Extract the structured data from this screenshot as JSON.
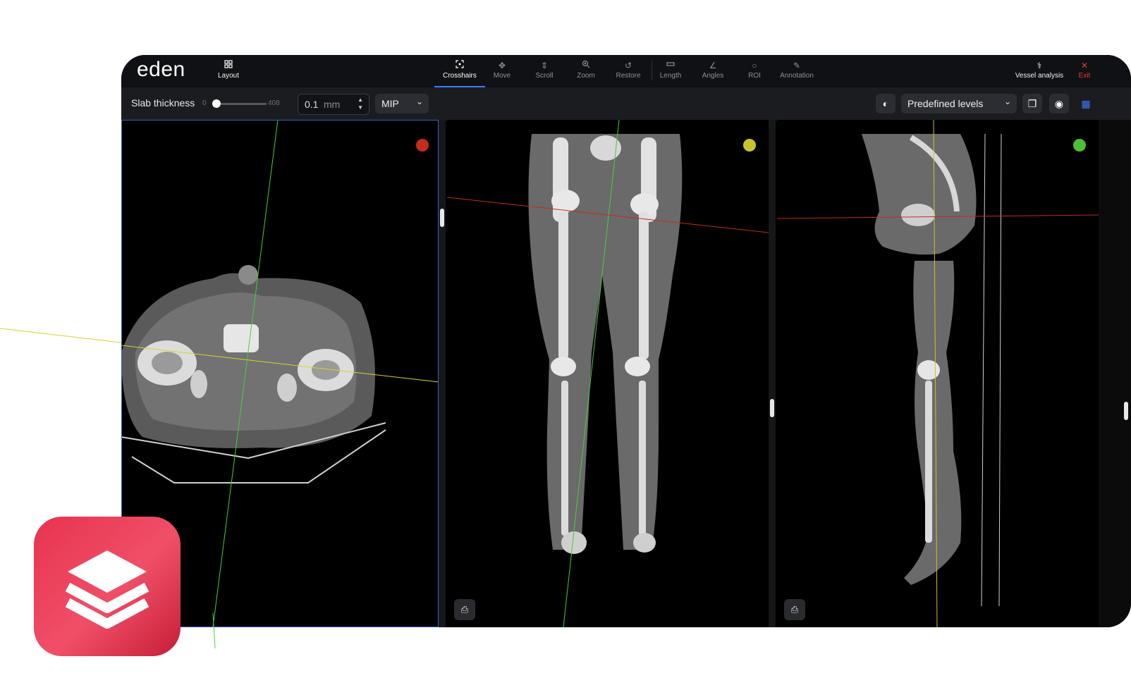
{
  "app": {
    "logo": "eden",
    "layout_label": "Layout",
    "tools": [
      {
        "label": "Crosshairs",
        "icon": "crosshairs-icon",
        "active": true
      },
      {
        "label": "Move",
        "icon": "move-icon"
      },
      {
        "label": "Scroll",
        "icon": "scroll-icon"
      },
      {
        "label": "Zoom",
        "icon": "zoom-icon"
      },
      {
        "label": "Restore",
        "icon": "restore-icon"
      },
      {
        "label": "Length",
        "icon": "length-icon"
      },
      {
        "label": "Angles",
        "icon": "angles-icon"
      },
      {
        "label": "ROI",
        "icon": "roi-icon"
      },
      {
        "label": "Annotation",
        "icon": "annotation-icon"
      }
    ],
    "vessel_analysis": "Vessel analysis",
    "exit": "Exit",
    "accent": "#3d7bff",
    "exit_color": "#e53935"
  },
  "toolbar": {
    "slab_label": "Slab thickness",
    "slab_min": "0",
    "slab_max": "408",
    "slab_level": 0.02,
    "slab_value": "0.1",
    "slab_unit": "mm",
    "mode": "MIP",
    "levels_placeholder": "Predefined levels"
  },
  "viewports": [
    {
      "name": "axial",
      "dot_color": "#c62b1c"
    },
    {
      "name": "coronal",
      "dot_color": "#c9c42c"
    },
    {
      "name": "sagittal",
      "dot_color": "#4fbf3a"
    }
  ]
}
